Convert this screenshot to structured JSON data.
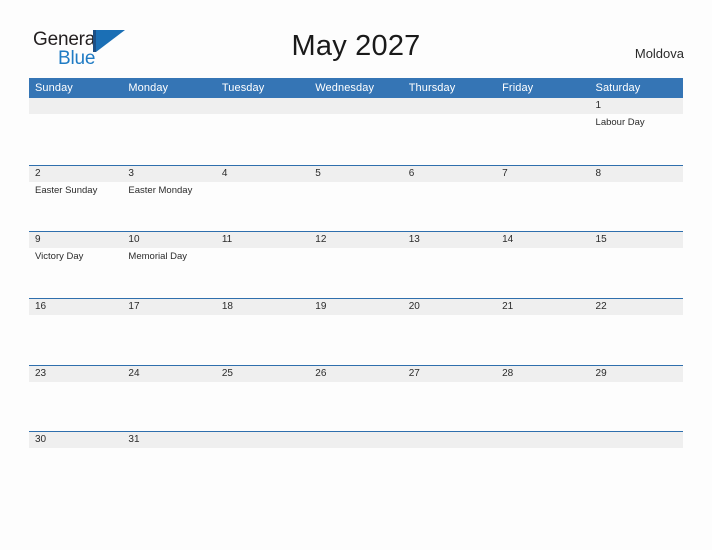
{
  "brand": {
    "name_part1": "General",
    "name_part2": "Blue",
    "mark_icon": "flag-triangle-icon"
  },
  "header": {
    "title": "May 2027",
    "country": "Moldova"
  },
  "colors": {
    "header_blue": "#3575b5",
    "row_rule_blue": "#2f6fad",
    "day_band_gray": "#efefef",
    "brand_blue": "#1f7bc4",
    "page_background": "#fdfdfd",
    "text": "#2b2b2b"
  },
  "calendar": {
    "weekdays": [
      "Sunday",
      "Monday",
      "Tuesday",
      "Wednesday",
      "Thursday",
      "Friday",
      "Saturday"
    ],
    "weeks": [
      [
        {
          "date": "",
          "events": []
        },
        {
          "date": "",
          "events": []
        },
        {
          "date": "",
          "events": []
        },
        {
          "date": "",
          "events": []
        },
        {
          "date": "",
          "events": []
        },
        {
          "date": "",
          "events": []
        },
        {
          "date": "1",
          "events": [
            "Labour Day"
          ]
        }
      ],
      [
        {
          "date": "2",
          "events": [
            "Easter Sunday"
          ]
        },
        {
          "date": "3",
          "events": [
            "Easter Monday"
          ]
        },
        {
          "date": "4",
          "events": []
        },
        {
          "date": "5",
          "events": []
        },
        {
          "date": "6",
          "events": []
        },
        {
          "date": "7",
          "events": []
        },
        {
          "date": "8",
          "events": []
        }
      ],
      [
        {
          "date": "9",
          "events": [
            "Victory Day"
          ]
        },
        {
          "date": "10",
          "events": [
            "Memorial Day"
          ]
        },
        {
          "date": "11",
          "events": []
        },
        {
          "date": "12",
          "events": []
        },
        {
          "date": "13",
          "events": []
        },
        {
          "date": "14",
          "events": []
        },
        {
          "date": "15",
          "events": []
        }
      ],
      [
        {
          "date": "16",
          "events": []
        },
        {
          "date": "17",
          "events": []
        },
        {
          "date": "18",
          "events": []
        },
        {
          "date": "19",
          "events": []
        },
        {
          "date": "20",
          "events": []
        },
        {
          "date": "21",
          "events": []
        },
        {
          "date": "22",
          "events": []
        }
      ],
      [
        {
          "date": "23",
          "events": []
        },
        {
          "date": "24",
          "events": []
        },
        {
          "date": "25",
          "events": []
        },
        {
          "date": "26",
          "events": []
        },
        {
          "date": "27",
          "events": []
        },
        {
          "date": "28",
          "events": []
        },
        {
          "date": "29",
          "events": []
        }
      ],
      [
        {
          "date": "30",
          "events": []
        },
        {
          "date": "31",
          "events": []
        },
        {
          "date": "",
          "events": []
        },
        {
          "date": "",
          "events": []
        },
        {
          "date": "",
          "events": []
        },
        {
          "date": "",
          "events": []
        },
        {
          "date": "",
          "events": []
        }
      ]
    ]
  }
}
